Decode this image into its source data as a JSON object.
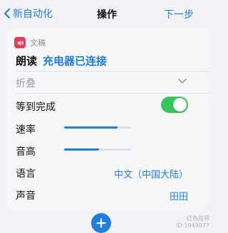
{
  "nav": {
    "back_label": "新自动化",
    "title": "操作",
    "next_label": "下一步"
  },
  "action": {
    "app_name": "文稿",
    "verb": "朗读",
    "parameter": "充电器已连接",
    "fold_label": "折叠",
    "wait_label": "等到完成",
    "wait_enabled": true,
    "rate_label": "速率",
    "rate_level": 0.8,
    "pitch_label": "音高",
    "pitch_level": 0.52,
    "language_label": "语言",
    "language_value": "中文（中国大陆）",
    "voice_label": "声音",
    "voice_value": "田田"
  },
  "colors": {
    "accent": "#1e7fe0",
    "toggle_on": "#34c759",
    "app_icon": "#e63e5c",
    "background": "#f2f2f7"
  },
  "watermark": {
    "line1": "红色巫师",
    "line2": "ID:1949077"
  }
}
